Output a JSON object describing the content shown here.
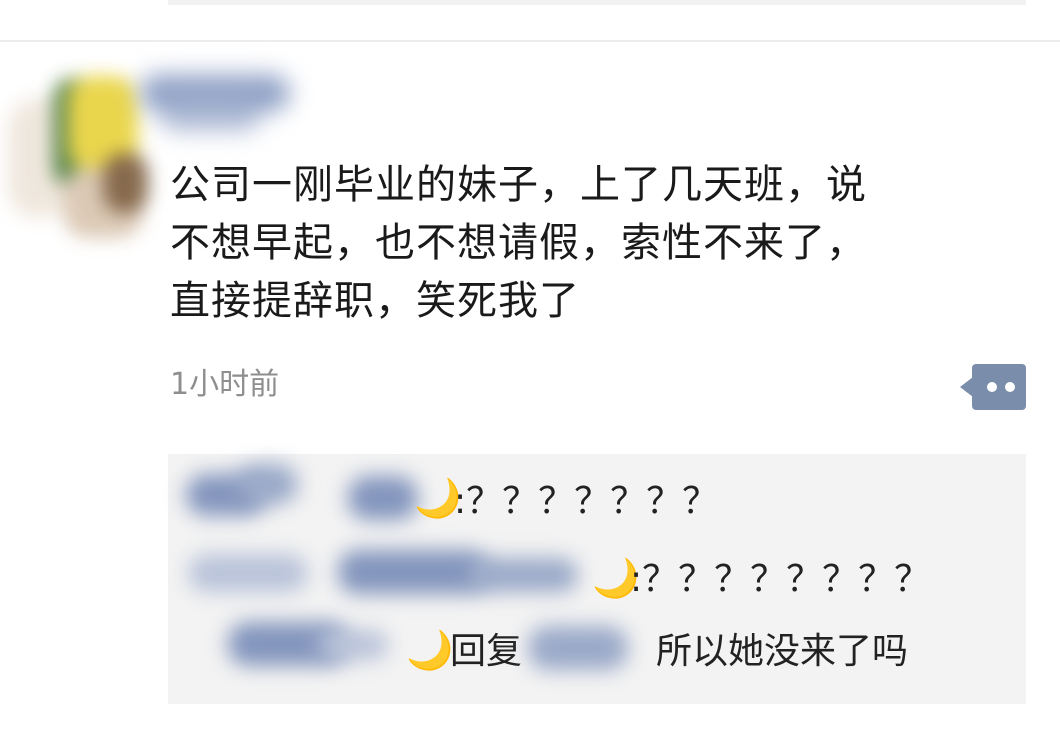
{
  "post": {
    "lines": [
      "公司一刚毕业的妹子，上了几天班，说",
      "不想早起，也不想请假，索性不来了，",
      "直接提辞职，笑死我了"
    ],
    "timestamp": "1小时前"
  },
  "more_button": {
    "icon": "more-dots-icon",
    "color": "#7a8dab"
  },
  "replies": [
    {
      "emoji": "moon-icon",
      "text": ":？？？？？？？"
    },
    {
      "emoji": "moon-icon",
      "text": ":？？？？？？？？"
    },
    {
      "emoji": "moon-icon",
      "reply_word": "回复",
      "text": "所以她没来了吗"
    }
  ],
  "colors": {
    "name_blue": "#5b6b95",
    "timestamp_gray": "#8e8e8e",
    "reply_bg": "#f3f3f3"
  }
}
